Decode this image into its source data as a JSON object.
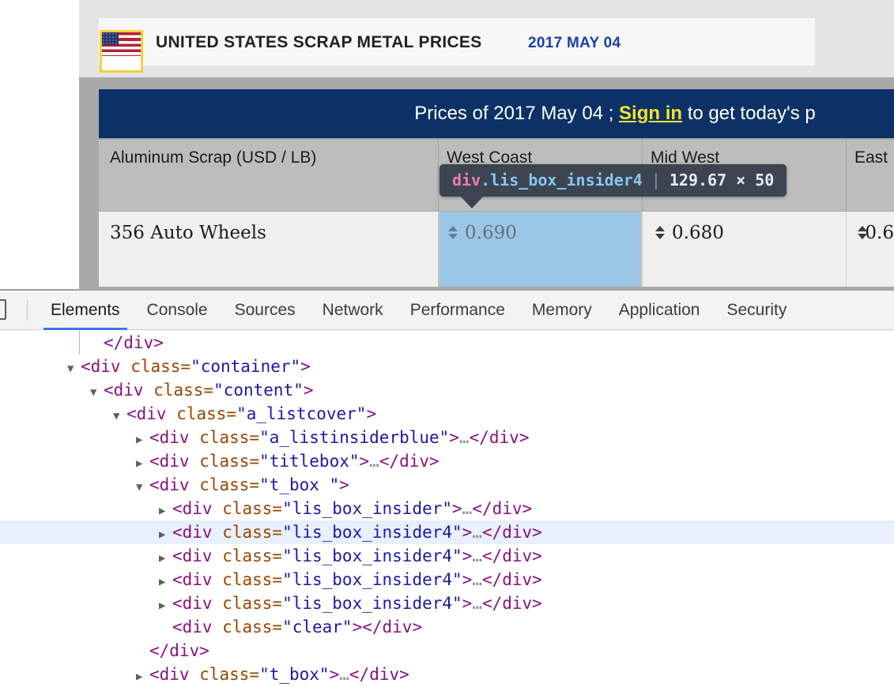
{
  "page": {
    "header": {
      "flag_icon": "us-flag-icon",
      "title": "UNITED STATES SCRAP METAL PRICES",
      "date": "2017 MAY 04"
    },
    "banner": {
      "prefix": "Prices of 2017 May 04 ; ",
      "link": "Sign in",
      "suffix": " to get today's p",
      "background": "#0c3166",
      "link_color": "#f3e32b"
    },
    "table": {
      "columns": [
        "Aluminum Scrap (USD / LB)",
        "West Coast",
        "Mid West",
        "East"
      ],
      "rows": [
        {
          "name": "356 Auto Wheels",
          "west_coast": "0.690",
          "mid_west": "0.680",
          "east": "0.6"
        }
      ],
      "sort_icon": "sort-updown-icon",
      "highlight_color": "#9cc6e6"
    }
  },
  "inspector_tooltip": {
    "tag": "div",
    "class": ".lis_box_insider4",
    "separator": "|",
    "dimensions": "129.67 × 50"
  },
  "devtools": {
    "device_toolbar_icon": "device-toolbar-icon",
    "tabs": [
      {
        "label": "Elements",
        "active": true
      },
      {
        "label": "Console",
        "active": false
      },
      {
        "label": "Sources",
        "active": false
      },
      {
        "label": "Network",
        "active": false
      },
      {
        "label": "Performance",
        "active": false
      },
      {
        "label": "Memory",
        "active": false
      },
      {
        "label": "Application",
        "active": false
      },
      {
        "label": "Security",
        "active": false
      }
    ],
    "dom_tree": [
      {
        "indent": 2,
        "arrow": "none",
        "selected": false,
        "guide": true,
        "parts": [
          {
            "t": "pk",
            "v": "</div>"
          }
        ]
      },
      {
        "indent": 1,
        "arrow": "open",
        "selected": false,
        "guide": false,
        "parts": [
          {
            "t": "pk",
            "v": "<div "
          },
          {
            "t": "at",
            "v": "class="
          },
          {
            "t": "av",
            "v": "\"container\""
          },
          {
            "t": "pk",
            "v": ">"
          }
        ]
      },
      {
        "indent": 2,
        "arrow": "open",
        "selected": false,
        "guide": false,
        "parts": [
          {
            "t": "pk",
            "v": "<div "
          },
          {
            "t": "at",
            "v": "class="
          },
          {
            "t": "av",
            "v": "\"content\""
          },
          {
            "t": "pk",
            "v": ">"
          }
        ]
      },
      {
        "indent": 3,
        "arrow": "open",
        "selected": false,
        "guide": false,
        "parts": [
          {
            "t": "pk",
            "v": "<div "
          },
          {
            "t": "at",
            "v": "class="
          },
          {
            "t": "av",
            "v": "\"a_listcover\""
          },
          {
            "t": "pk",
            "v": ">"
          }
        ]
      },
      {
        "indent": 4,
        "arrow": "closed",
        "selected": false,
        "guide": false,
        "parts": [
          {
            "t": "pk",
            "v": "<div "
          },
          {
            "t": "at",
            "v": "class="
          },
          {
            "t": "av",
            "v": "\"a_listinsiderblue\""
          },
          {
            "t": "pk",
            "v": ">"
          },
          {
            "t": "el",
            "v": "…"
          },
          {
            "t": "pk",
            "v": "</div>"
          }
        ]
      },
      {
        "indent": 4,
        "arrow": "closed",
        "selected": false,
        "guide": false,
        "parts": [
          {
            "t": "pk",
            "v": "<div "
          },
          {
            "t": "at",
            "v": "class="
          },
          {
            "t": "av",
            "v": "\"titlebox\""
          },
          {
            "t": "pk",
            "v": ">"
          },
          {
            "t": "el",
            "v": "…"
          },
          {
            "t": "pk",
            "v": "</div>"
          }
        ]
      },
      {
        "indent": 4,
        "arrow": "open",
        "selected": false,
        "guide": false,
        "parts": [
          {
            "t": "pk",
            "v": "<div "
          },
          {
            "t": "at",
            "v": "class="
          },
          {
            "t": "av",
            "v": "\"t_box \""
          },
          {
            "t": "pk",
            "v": ">"
          }
        ]
      },
      {
        "indent": 5,
        "arrow": "closed",
        "selected": false,
        "guide": false,
        "parts": [
          {
            "t": "pk",
            "v": "<div "
          },
          {
            "t": "at",
            "v": "class="
          },
          {
            "t": "av",
            "v": "\"lis_box_insider\""
          },
          {
            "t": "pk",
            "v": ">"
          },
          {
            "t": "el",
            "v": "…"
          },
          {
            "t": "pk",
            "v": "</div>"
          }
        ]
      },
      {
        "indent": 5,
        "arrow": "closed",
        "selected": true,
        "guide": false,
        "parts": [
          {
            "t": "pk",
            "v": "<div "
          },
          {
            "t": "at",
            "v": "class="
          },
          {
            "t": "av",
            "v": "\"lis_box_insider4\""
          },
          {
            "t": "pk",
            "v": ">"
          },
          {
            "t": "el",
            "v": "…"
          },
          {
            "t": "pk",
            "v": "</div>"
          }
        ]
      },
      {
        "indent": 5,
        "arrow": "closed",
        "selected": false,
        "guide": false,
        "parts": [
          {
            "t": "pk",
            "v": "<div "
          },
          {
            "t": "at",
            "v": "class="
          },
          {
            "t": "av",
            "v": "\"lis_box_insider4\""
          },
          {
            "t": "pk",
            "v": ">"
          },
          {
            "t": "el",
            "v": "…"
          },
          {
            "t": "pk",
            "v": "</div>"
          }
        ]
      },
      {
        "indent": 5,
        "arrow": "closed",
        "selected": false,
        "guide": false,
        "parts": [
          {
            "t": "pk",
            "v": "<div "
          },
          {
            "t": "at",
            "v": "class="
          },
          {
            "t": "av",
            "v": "\"lis_box_insider4\""
          },
          {
            "t": "pk",
            "v": ">"
          },
          {
            "t": "el",
            "v": "…"
          },
          {
            "t": "pk",
            "v": "</div>"
          }
        ]
      },
      {
        "indent": 5,
        "arrow": "closed",
        "selected": false,
        "guide": false,
        "parts": [
          {
            "t": "pk",
            "v": "<div "
          },
          {
            "t": "at",
            "v": "class="
          },
          {
            "t": "av",
            "v": "\"lis_box_insider4\""
          },
          {
            "t": "pk",
            "v": ">"
          },
          {
            "t": "el",
            "v": "…"
          },
          {
            "t": "pk",
            "v": "</div>"
          }
        ]
      },
      {
        "indent": 5,
        "arrow": "none",
        "selected": false,
        "guide": false,
        "parts": [
          {
            "t": "pk",
            "v": "<div "
          },
          {
            "t": "at",
            "v": "class="
          },
          {
            "t": "av",
            "v": "\"clear\""
          },
          {
            "t": "pk",
            "v": "></div>"
          }
        ]
      },
      {
        "indent": 4,
        "arrow": "none",
        "selected": false,
        "guide": false,
        "parts": [
          {
            "t": "pk",
            "v": "</div>"
          }
        ]
      },
      {
        "indent": 4,
        "arrow": "closed",
        "selected": false,
        "guide": false,
        "parts": [
          {
            "t": "pk",
            "v": "<div "
          },
          {
            "t": "at",
            "v": "class="
          },
          {
            "t": "av",
            "v": "\"t_box\""
          },
          {
            "t": "pk",
            "v": ">"
          },
          {
            "t": "el",
            "v": "…"
          },
          {
            "t": "pk",
            "v": "</div>"
          }
        ]
      }
    ]
  }
}
